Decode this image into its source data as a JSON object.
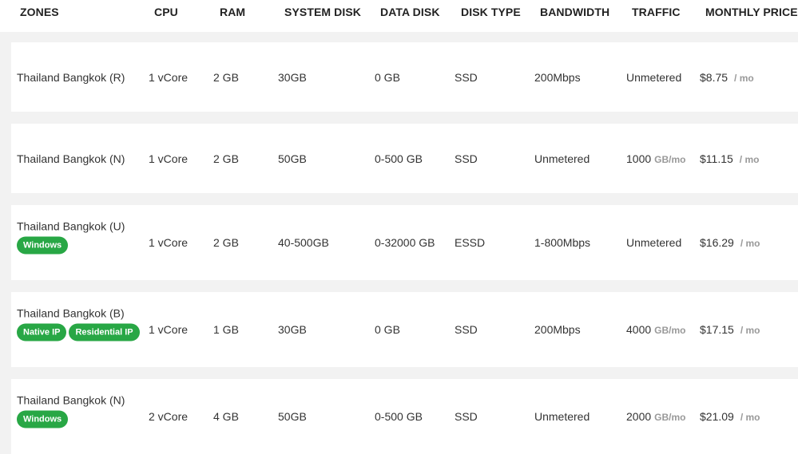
{
  "columns": {
    "zones": "ZONES",
    "cpu": "CPU",
    "ram": "RAM",
    "system_disk": "SYSTEM DISK",
    "data_disk": "DATA DISK",
    "disk_type": "DISK TYPE",
    "bandwidth": "BANDWIDTH",
    "traffic": "TRAFFIC",
    "monthly_price": "MONTHLY PRICE"
  },
  "plans": [
    {
      "zone": "Thailand Bangkok (R)",
      "badges": [],
      "cpu": "1 vCore",
      "ram": "2 GB",
      "system_disk": "30GB",
      "data_disk": "0 GB",
      "disk_type": "SSD",
      "bandwidth": "200Mbps",
      "traffic": "Unmetered",
      "traffic_unit": "",
      "price": "$8.75",
      "price_unit": "/ mo"
    },
    {
      "zone": "Thailand Bangkok (N)",
      "badges": [],
      "cpu": "1 vCore",
      "ram": "2 GB",
      "system_disk": "50GB",
      "data_disk": "0-500 GB",
      "disk_type": "SSD",
      "bandwidth": "Unmetered",
      "traffic": "1000",
      "traffic_unit": "GB/mo",
      "price": "$11.15",
      "price_unit": "/ mo"
    },
    {
      "zone": "Thailand Bangkok (U)",
      "badges": [
        "Windows"
      ],
      "cpu": "1 vCore",
      "ram": "2 GB",
      "system_disk": "40-500GB",
      "data_disk": "0-32000 GB",
      "disk_type": "ESSD",
      "bandwidth": "1-800Mbps",
      "traffic": "Unmetered",
      "traffic_unit": "",
      "price": "$16.29",
      "price_unit": "/ mo"
    },
    {
      "zone": "Thailand Bangkok (B)",
      "badges": [
        "Native IP",
        "Residential IP"
      ],
      "cpu": "1 vCore",
      "ram": "1 GB",
      "system_disk": "30GB",
      "data_disk": "0 GB",
      "disk_type": "SSD",
      "bandwidth": "200Mbps",
      "traffic": "4000",
      "traffic_unit": "GB/mo",
      "price": "$17.15",
      "price_unit": "/ mo"
    },
    {
      "zone": "Thailand Bangkok (N)",
      "badges": [
        "Windows"
      ],
      "cpu": "2 vCore",
      "ram": "4 GB",
      "system_disk": "50GB",
      "data_disk": "0-500 GB",
      "disk_type": "SSD",
      "bandwidth": "Unmetered",
      "traffic": "2000",
      "traffic_unit": "GB/mo",
      "price": "$21.09",
      "price_unit": "/ mo"
    }
  ]
}
